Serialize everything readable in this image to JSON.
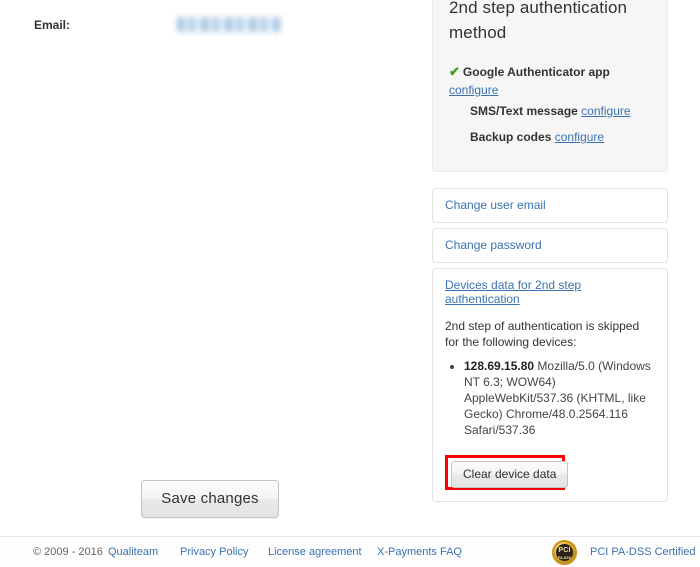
{
  "form": {
    "email_label": "Email:",
    "email_value_redacted": true,
    "save_button": "Save changes"
  },
  "sidebar": {
    "auth_panel": {
      "title": "2nd step authentication method",
      "methods": [
        {
          "name": "Google Authenticator app",
          "active": true,
          "check_icon": "check-icon",
          "configure_label": "configure",
          "configure_below": true
        },
        {
          "name": "SMS/Text message",
          "active": false,
          "configure_label": "configure",
          "configure_below": false
        },
        {
          "name": "Backup codes",
          "active": false,
          "configure_label": "configure",
          "configure_below": false
        }
      ]
    },
    "nav_links": [
      {
        "label": "Change user email"
      },
      {
        "label": "Change password"
      }
    ],
    "devices_panel": {
      "heading": "Devices data for 2nd step authentication",
      "description": "2nd step of authentication is skipped for the following devices:",
      "devices": [
        {
          "ip": "128.69.15.80",
          "user_agent": "Mozilla/5.0 (Windows NT 6.3; WOW64) AppleWebKit/537.36 (KHTML, like Gecko) Chrome/48.0.2564.116 Safari/537.36"
        }
      ],
      "clear_button": "Clear device data",
      "highlight_color": "#fd0000"
    }
  },
  "footer": {
    "copyright": "© 2009 - 2016",
    "links": [
      {
        "label": "Qualiteam"
      },
      {
        "label": "Privacy Policy"
      },
      {
        "label": "License agreement"
      },
      {
        "label": "X-Payments FAQ"
      }
    ],
    "badge": {
      "icon": "pci-seal-icon",
      "mark": "PCI",
      "submark": "PA-DSS",
      "text": "PCI PA-DSS Certified"
    }
  },
  "colors": {
    "link": "#3b73af",
    "check": "#3f9c23",
    "highlight": "#fd0000",
    "panel_bg": "#f6f6f6"
  }
}
